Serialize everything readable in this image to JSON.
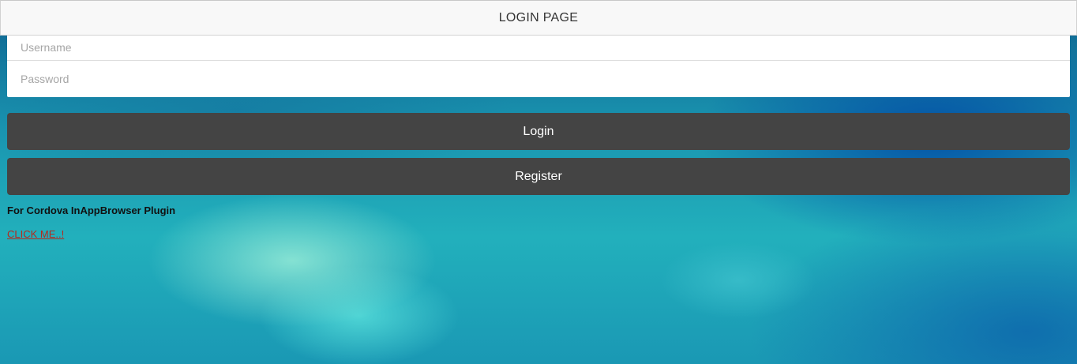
{
  "header": {
    "title": "LOGIN PAGE"
  },
  "form": {
    "username": {
      "placeholder": "Username",
      "value": ""
    },
    "password": {
      "placeholder": "Password",
      "value": ""
    }
  },
  "buttons": {
    "login_label": "Login",
    "register_label": "Register"
  },
  "plugin_note": "For Cordova InAppBrowser Plugin",
  "plugin_link": "CLICK ME..!",
  "colors": {
    "header_bg": "#f8f8f8",
    "button_bg": "#444444",
    "link": "#b52a1e"
  }
}
